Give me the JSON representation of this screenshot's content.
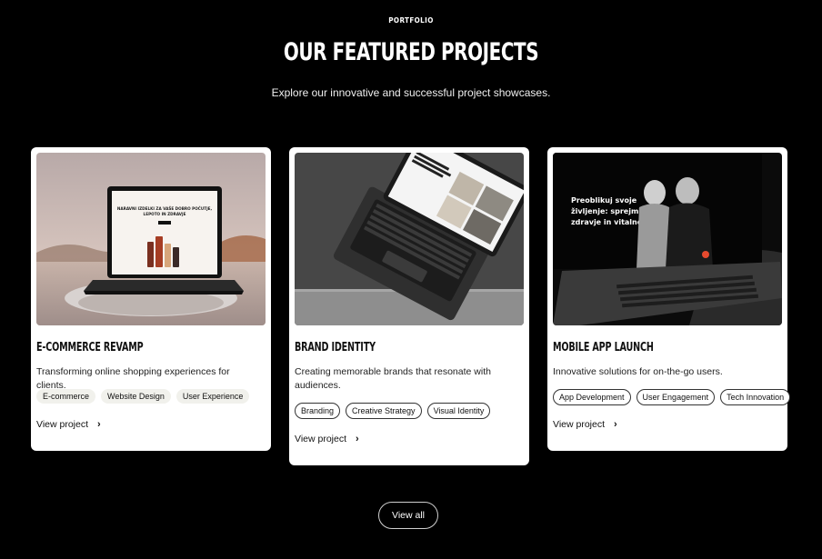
{
  "header": {
    "eyebrow": "PORTFOLIO",
    "title": "OUR FEATURED PROJECTS",
    "subtitle": "Explore our innovative and successful project showcases."
  },
  "projects": [
    {
      "title": "E-COMMERCE REVAMP",
      "description": "Transforming online shopping experiences for clients.",
      "tags": [
        "E-commerce",
        "Website Design",
        "User Experience"
      ],
      "link": "View project",
      "screen_text": "NARAVNI IZDELKI ZA VAŠE DOBRO POČUTJE, LEPOTO IN ZDRAVJE"
    },
    {
      "title": "BRAND IDENTITY",
      "description": "Creating memorable brands that resonate with audiences.",
      "tags": [
        "Branding",
        "Creative Strategy",
        "Visual Identity"
      ],
      "link": "View project"
    },
    {
      "title": "MOBILE APP LAUNCH",
      "description": "Innovative solutions for on-the-go users.",
      "tags": [
        "App Development",
        "User Engagement",
        "Tech Innovation"
      ],
      "link": "View project",
      "screen_text": [
        "Preoblikuj svoje",
        "življenje: sprejmi",
        "zdravje in vitalnost!"
      ]
    }
  ],
  "view_all": "View all",
  "icons": {
    "chevron": "chevron-right-icon"
  }
}
